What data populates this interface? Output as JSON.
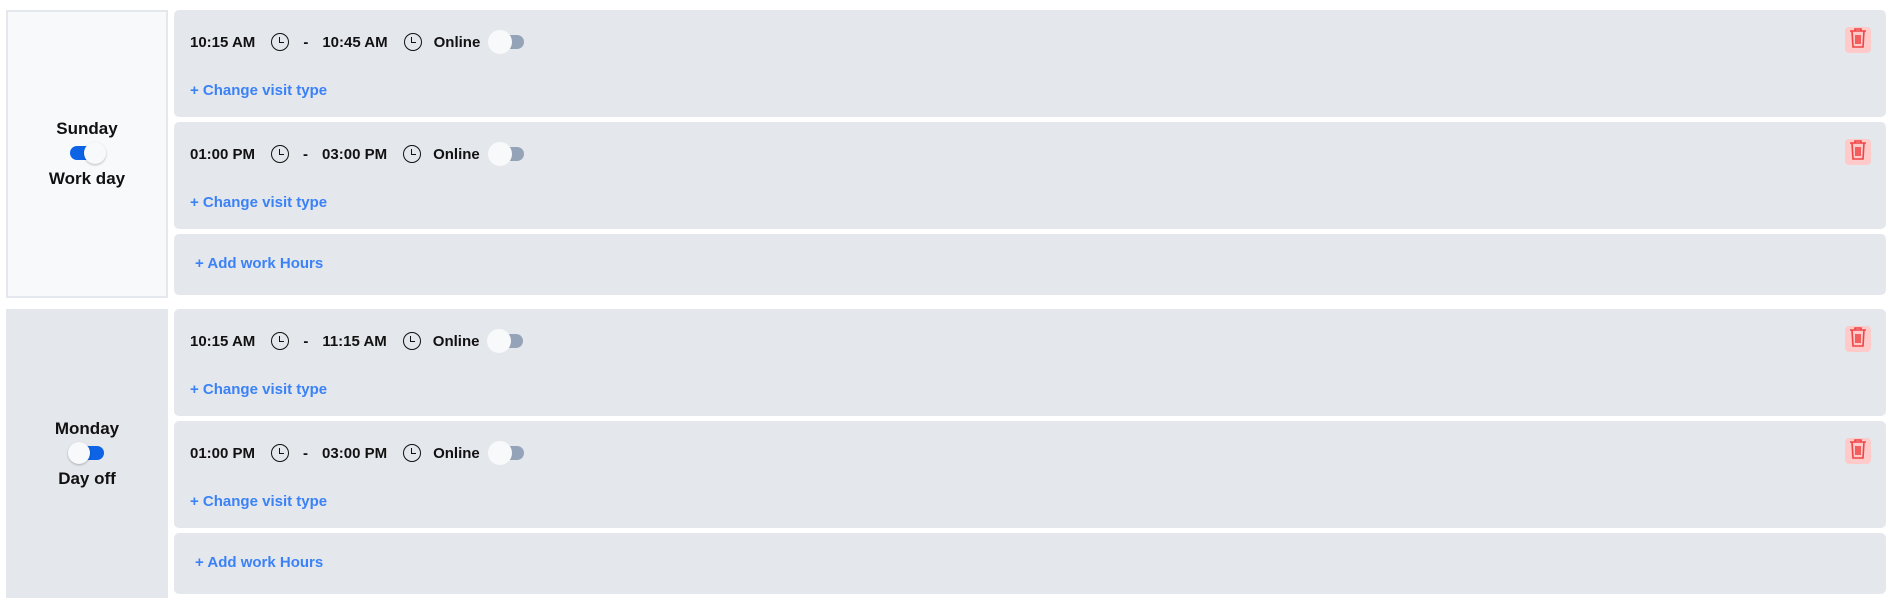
{
  "days": [
    {
      "name": "Sunday",
      "status": "Work day",
      "enabled": true,
      "slots": [
        {
          "start": "10:15 AM",
          "end": "10:45 AM",
          "type": "Online",
          "type_on": false,
          "change": "+ Change visit type"
        },
        {
          "start": "01:00 PM",
          "end": "03:00 PM",
          "type": "Online",
          "type_on": false,
          "change": "+ Change visit type"
        }
      ],
      "add": "+ Add work Hours"
    },
    {
      "name": "Monday",
      "status": "Day off",
      "enabled": false,
      "slots": [
        {
          "start": "10:15 AM",
          "end": "11:15 AM",
          "type": "Online",
          "type_on": false,
          "change": "+ Change visit type"
        },
        {
          "start": "01:00 PM",
          "end": "03:00 PM",
          "type": "Online",
          "type_on": false,
          "change": "+ Change visit type"
        }
      ],
      "add": "+ Add work Hours"
    }
  ],
  "icons": {
    "time": "clock-icon",
    "delete": "trash-icon"
  },
  "colors": {
    "accent": "#3b82f6",
    "toggle_on": "#0d63e6",
    "danger": "#ef4444"
  }
}
